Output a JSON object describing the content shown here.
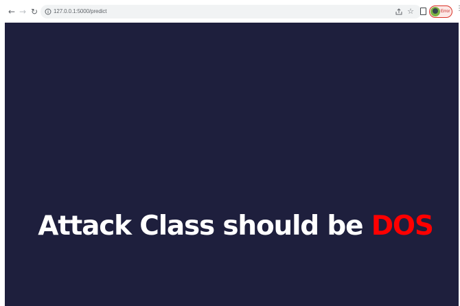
{
  "browser": {
    "url": "127.0.0.1:5000/predict",
    "profile_status": "Error",
    "icons": {
      "back": "arrow-left-icon",
      "forward": "arrow-right-icon",
      "reload": "reload-icon",
      "site_info": "info-icon",
      "share": "share-icon",
      "bookmark": "star-icon",
      "side_panel": "side-panel-icon",
      "menu": "more-vert-icon"
    }
  },
  "page": {
    "background_color": "#1e1f3d",
    "result_prefix": "Attack Class should be ",
    "result_value": "DOS",
    "result_value_color": "#ff0000"
  }
}
